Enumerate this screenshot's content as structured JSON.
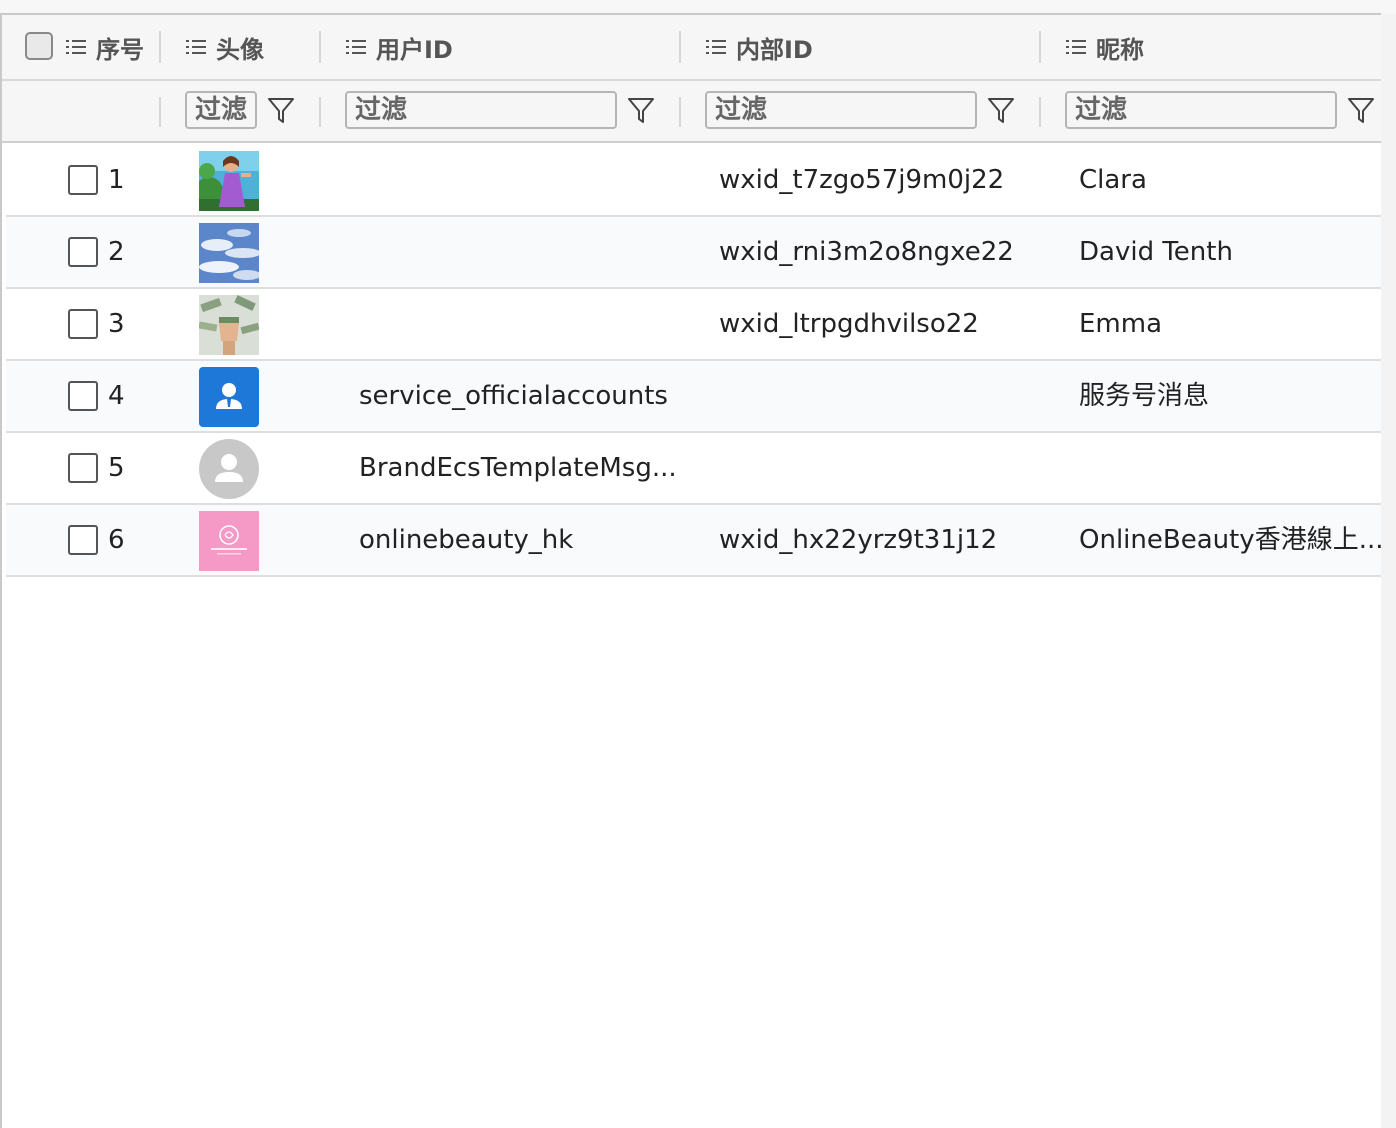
{
  "header": {
    "columns": [
      {
        "label": "序号"
      },
      {
        "label": "头像"
      },
      {
        "label": "用户ID"
      },
      {
        "label": "内部ID"
      },
      {
        "label": "昵称"
      }
    ]
  },
  "filters": {
    "placeholder": "过滤"
  },
  "rows": [
    {
      "index": "1",
      "avatar": "avatar-cartoon-girl",
      "user_id": "",
      "internal_id": "wxid_t7zgo57j9m0j22",
      "nickname": "Clara"
    },
    {
      "index": "2",
      "avatar": "avatar-sky-clouds",
      "user_id": "",
      "internal_id": "wxid_rni3m2o8ngxe22",
      "nickname": "David Tenth"
    },
    {
      "index": "3",
      "avatar": "avatar-hand-money",
      "user_id": "",
      "internal_id": "wxid_ltrpgdhvilso22",
      "nickname": "Emma"
    },
    {
      "index": "4",
      "avatar": "avatar-service-blue",
      "user_id": "service_officialaccounts",
      "internal_id": "",
      "nickname": "服务号消息"
    },
    {
      "index": "5",
      "avatar": "avatar-default-gray",
      "user_id": "BrandEcsTemplateMsg...",
      "internal_id": "",
      "nickname": ""
    },
    {
      "index": "6",
      "avatar": "avatar-pink-logo",
      "user_id": "onlinebeauty_hk",
      "internal_id": "wxid_hx22yrz9t31j12",
      "nickname": "OnlineBeauty香港線上..."
    }
  ],
  "colors": {
    "header_bg": "#f5f6f5",
    "alt_row_bg": "#f9fafc",
    "service_blue": "#1e78d7",
    "pink": "#f59ac6"
  }
}
